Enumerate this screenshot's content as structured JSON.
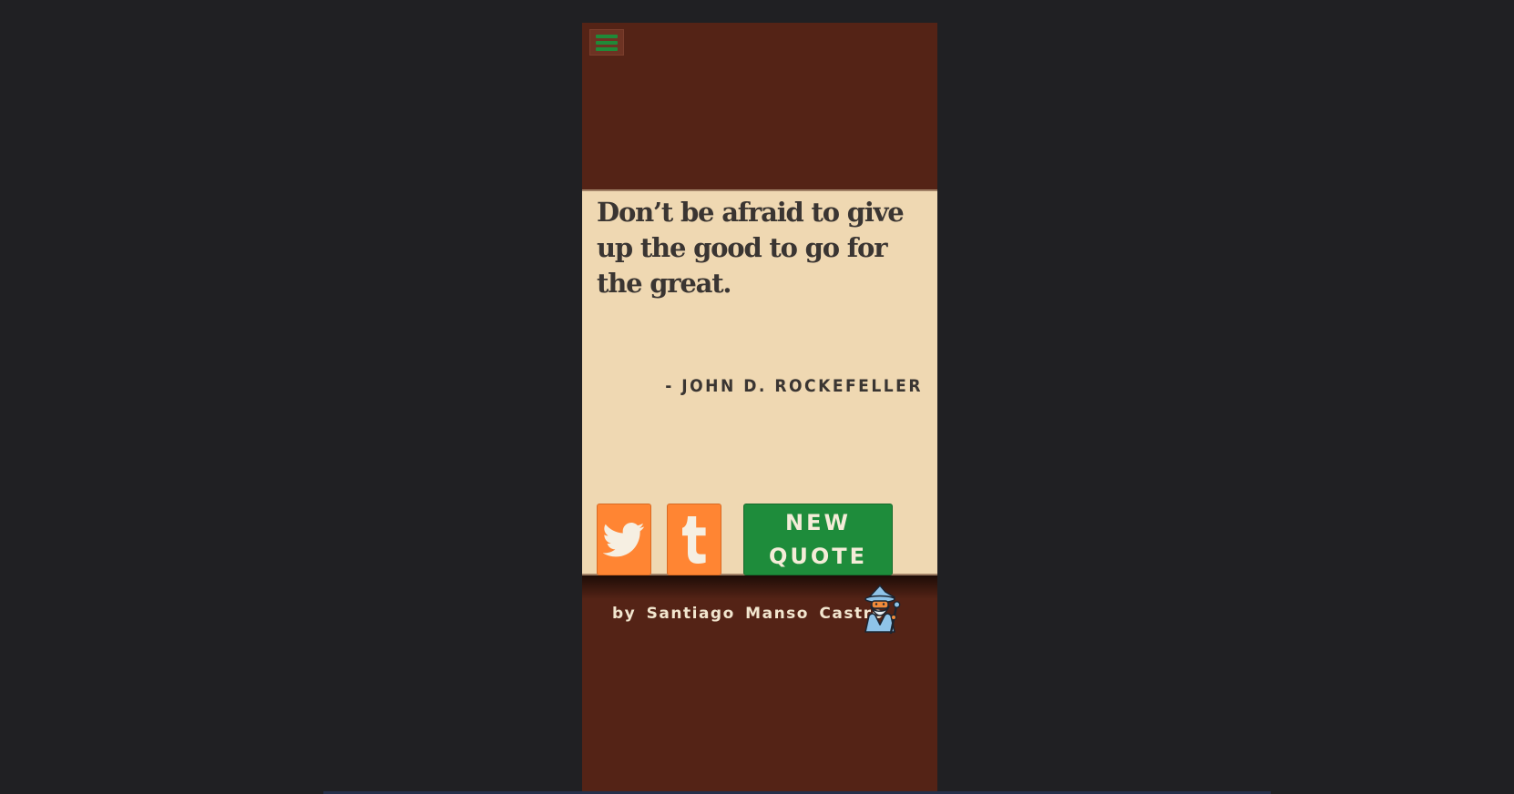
{
  "quote": {
    "text": "Don’t be afraid to give up the good to go for the great.",
    "author": "- JOHN D. ROCKEFELLER"
  },
  "buttons": {
    "new_quote_label": "NEW QUOTE",
    "twitter_icon": "twitter-icon",
    "tumblr_icon": "tumblr-icon",
    "menu_icon": "hamburger-menu-icon"
  },
  "footer": {
    "credit": "by Santiago Manso Castro",
    "avatar_icon": "wizard-icon"
  },
  "colors": {
    "page_background": "#202023",
    "app_background": "#542316",
    "card_background": "#efd8b2",
    "share_button": "#ff8533",
    "accent_green": "#1e8c3b",
    "text_dark": "#3a3532"
  }
}
